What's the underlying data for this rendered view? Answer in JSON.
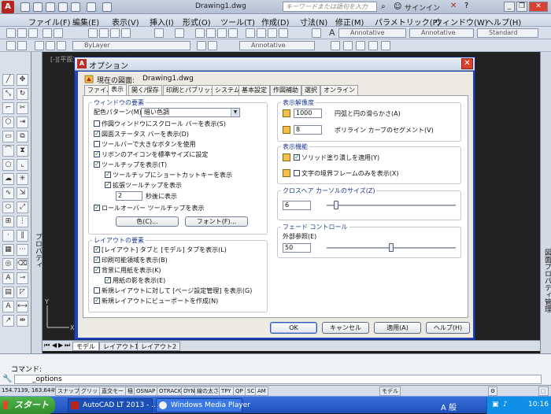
{
  "app": {
    "title": "Drawing1.dwg",
    "search_placeholder": "キーワードまたは語句を入力",
    "signin": "サインイン",
    "menu": [
      "ファイル(F)",
      "編集(E)",
      "表示(V)",
      "挿入(I)",
      "形式(O)",
      "ツール(T)",
      "作成(D)",
      "寸法(N)",
      "修正(M)",
      "パラメトリック(P)",
      "ウィンドウ(W)",
      "ヘルプ(H)"
    ],
    "combos": {
      "annotative1": "Annotative",
      "annotative2": "Annotative",
      "annotative3": "Annotative",
      "standard": "Standard",
      "bylayer": "ByLayer"
    },
    "properties_label": "プロパティ",
    "properties_manager_label": "図面プロパティ管理"
  },
  "layout_tabs": [
    "モデル",
    "レイアウト1",
    "レイアウト2"
  ],
  "command": {
    "label": "コマンド:",
    "input": "_options"
  },
  "status": {
    "coords": "154.7139, 163.6449, 0.0000",
    "buttons": [
      "スナップ",
      "グリッド",
      "直交モード",
      "極",
      "OSNAP",
      "OTRACK",
      "DYN",
      "線の太さ",
      "TPY",
      "QP",
      "SC",
      "AM"
    ],
    "right_label": "モデル"
  },
  "taskbar": {
    "start": "スタート",
    "tasks": [
      "AutoCAD LT 2013 - ...",
      "Windows Media Player"
    ],
    "tray_time": "10:16",
    "tray_ime": "A 般"
  },
  "dialog": {
    "title": "オプション",
    "profile_label": "現在の図面:",
    "profile_value": "Drawing1.dwg",
    "tabs": [
      "ファイル",
      "表示",
      "開く/保存",
      "印刷とパブリッシュ",
      "システム",
      "基本設定",
      "作図補助",
      "選択",
      "オンライン"
    ],
    "window_elements": {
      "title": "ウィンドウの要素",
      "color_scheme_label": "配色パターン(M):",
      "color_scheme_value": "暗い色調",
      "options": [
        {
          "label": "作図ウィンドウにスクロール バーを表示(S)",
          "checked": false
        },
        {
          "label": "図面ステータス バーを表示(D)",
          "checked": true
        },
        {
          "label": "ツールバーで大きなボタンを使用",
          "checked": false
        },
        {
          "label": "リボンのアイコンを標準サイズに設定",
          "checked": true
        },
        {
          "label": "ツールチップを表示(T)",
          "checked": true
        },
        {
          "label": "ツールチップにショートカットキーを表示",
          "checked": true
        },
        {
          "label": "拡張ツールチップを表示",
          "checked": true
        },
        {
          "label": "ロールオーバー ツールチップを表示",
          "checked": true
        }
      ],
      "delay_value": "2",
      "delay_label": "秒後に表示",
      "colors_button": "色(C)...",
      "fonts_button": "フォント(F)..."
    },
    "layout_elements": {
      "title": "レイアウトの要素",
      "options": [
        {
          "label": "[レイアウト] タブと [モデル] タブを表示(L)",
          "checked": true
        },
        {
          "label": "印刷可能領域を表示(B)",
          "checked": true
        },
        {
          "label": "背景に用紙を表示(K)",
          "checked": true
        },
        {
          "label": "用紙の影を表示(E)",
          "checked": true
        },
        {
          "label": "新規レイアウトに対して [ページ設定管理] を表示(G)",
          "checked": false
        },
        {
          "label": "新規レイアウトにビューポートを作成(N)",
          "checked": true
        }
      ]
    },
    "display_resolution": {
      "title": "表示解像度",
      "items": [
        {
          "value": "1000",
          "label": "円弧と円の滑らかさ(A)"
        },
        {
          "value": "8",
          "label": "ポリライン カーブのセグメント(V)"
        }
      ]
    },
    "display_performance": {
      "title": "表示機能",
      "options": [
        {
          "label": "ソリッド塗り潰しを適用(Y)",
          "checked": true
        },
        {
          "label": "文字の境界フレームのみを表示(X)",
          "checked": false
        }
      ]
    },
    "crosshair": {
      "title": "クロスヘア カーソルのサイズ(Z)",
      "value": "6",
      "level_percent": 6
    },
    "fade": {
      "title": "フェード コントロール",
      "xref_label": "外部参照(E)",
      "value": "50",
      "level_percent": 50
    },
    "buttons": {
      "ok": "OK",
      "cancel": "キャンセル",
      "apply": "適用(A)",
      "help": "ヘルプ(H)"
    }
  }
}
